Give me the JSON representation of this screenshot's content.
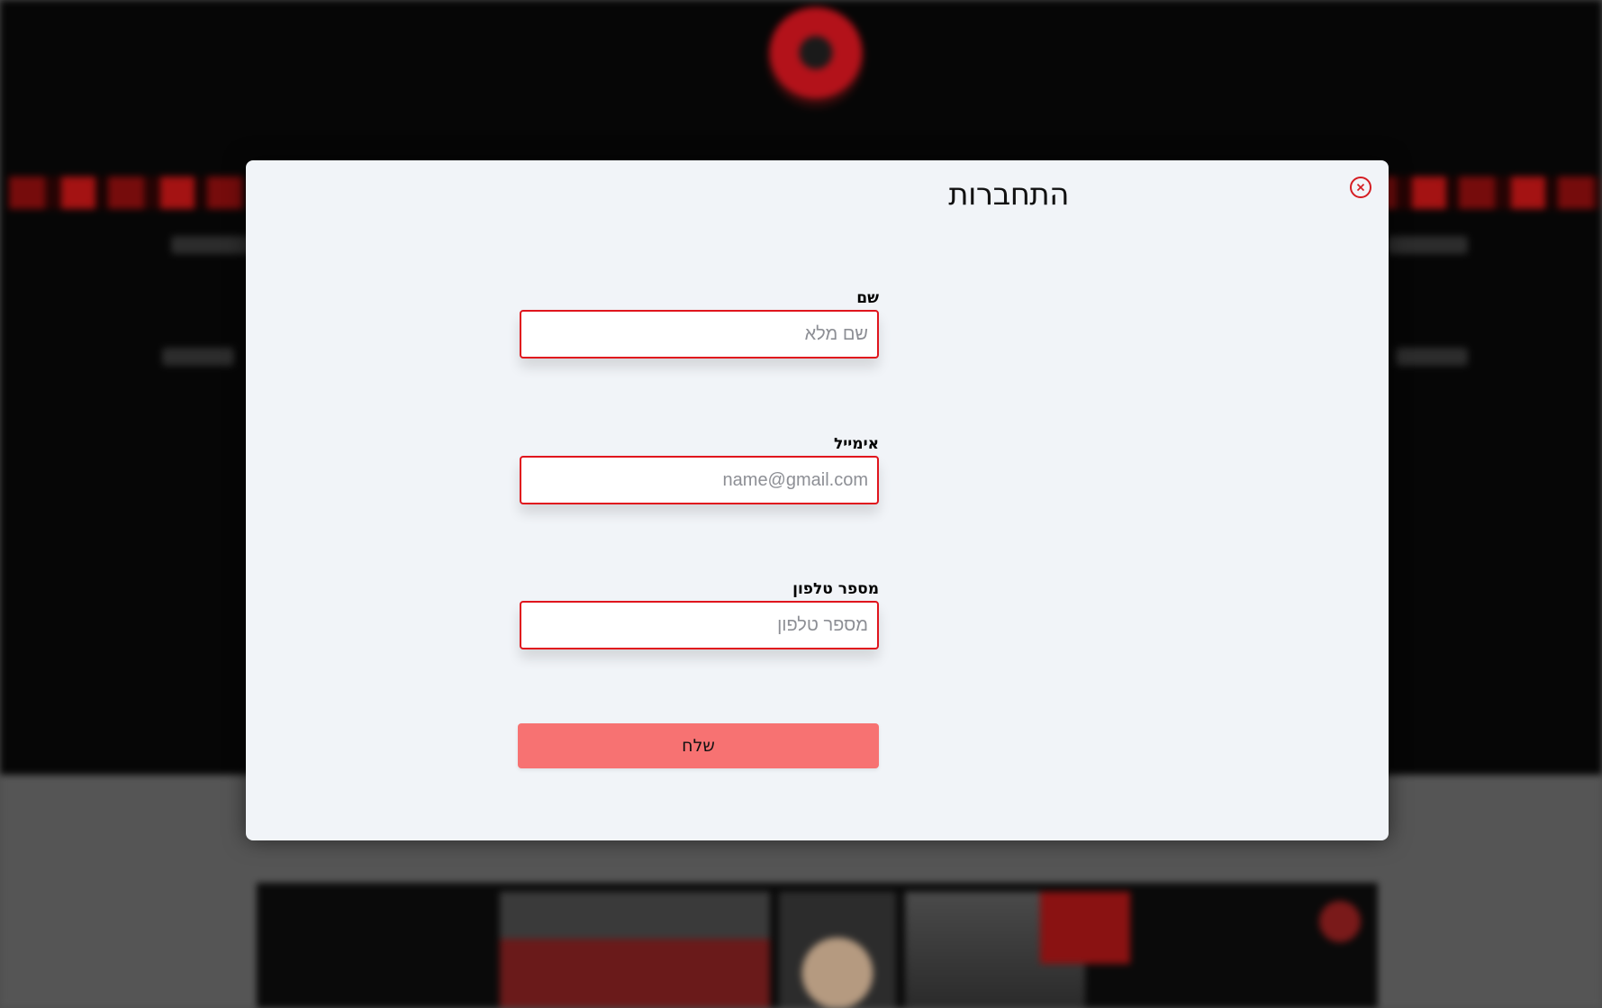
{
  "modal": {
    "title": "התחברות",
    "close_icon": "close-circle-icon",
    "accent_color": "#e0151d",
    "button_color": "#f77272"
  },
  "form": {
    "name": {
      "label": "שם",
      "placeholder": "שם מלא",
      "value": ""
    },
    "email": {
      "label": "אימייל",
      "placeholder": "name@gmail.com",
      "value": ""
    },
    "phone": {
      "label": "מספר טלפון",
      "placeholder": "מספר טלפון",
      "value": ""
    },
    "submit_label": "שלח"
  },
  "background": {
    "logo_icon": "site-logo-icon",
    "header_color": "#060606",
    "lower_color": "#555555"
  }
}
